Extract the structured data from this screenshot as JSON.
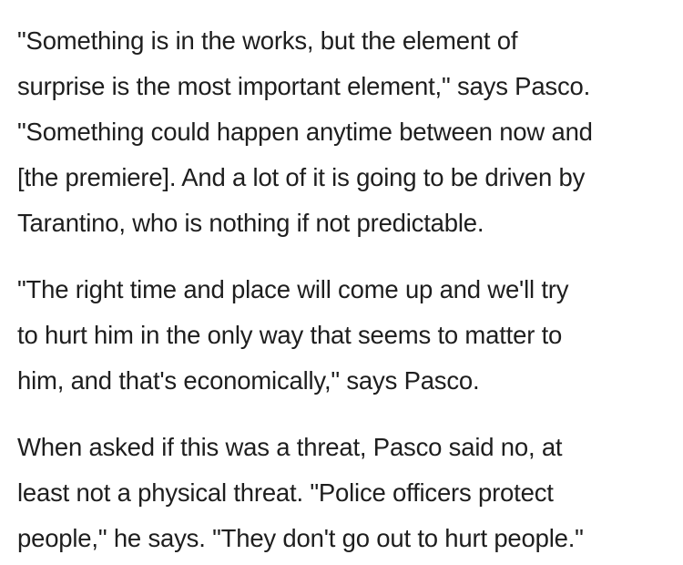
{
  "article": {
    "paragraphs": [
      {
        "lines": [
          "\"Something is in the works, but the element of",
          "surprise is the most important element,\" says Pasco.",
          "\"Something could happen anytime between now and",
          "[the premiere]. And a lot of it is going to be driven by",
          "Tarantino, who is nothing if not predictable."
        ]
      },
      {
        "lines": [
          "\"The right time and place will come up and we'll try",
          "to hurt him in the only way that seems to matter to",
          "him, and that's economically,\" says Pasco."
        ]
      },
      {
        "lines": [
          "When asked if this was a threat, Pasco said no, at",
          "least not a physical threat. \"Police officers protect",
          "people,\" he says. \"They don't go out to hurt people.\""
        ]
      }
    ]
  }
}
